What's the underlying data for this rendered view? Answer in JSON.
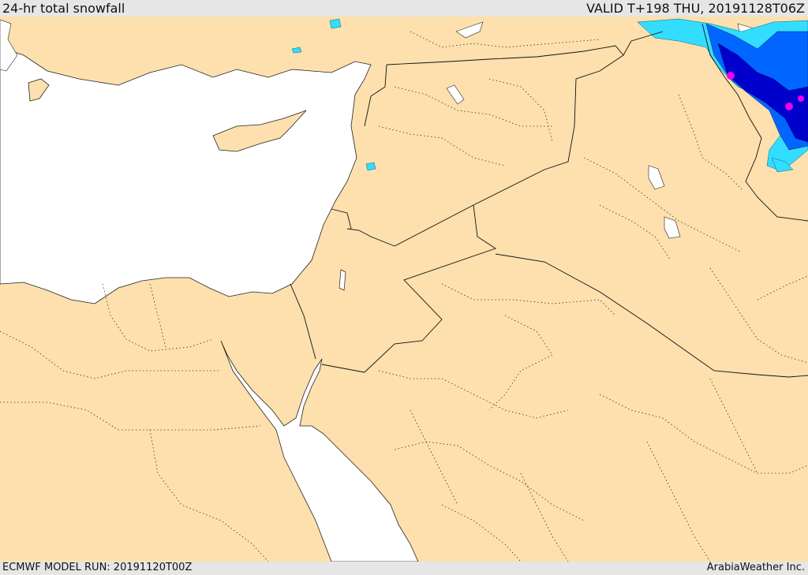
{
  "header": {
    "title": "24-hr total snowfall",
    "valid": "VALID T+198 THU, 20191128T06Z"
  },
  "footer": {
    "model_run": "ECMWF MODEL RUN: 20191120T00Z",
    "credit": "ArabiaWeather Inc."
  },
  "colors": {
    "land": "#fde0ad",
    "sea": "#ffffff",
    "border": "#1a1a1a",
    "snow_light": "#33ddff",
    "snow_medium": "#0066ff",
    "snow_heavy": "#0000cc",
    "snow_max": "#ee00ee"
  }
}
